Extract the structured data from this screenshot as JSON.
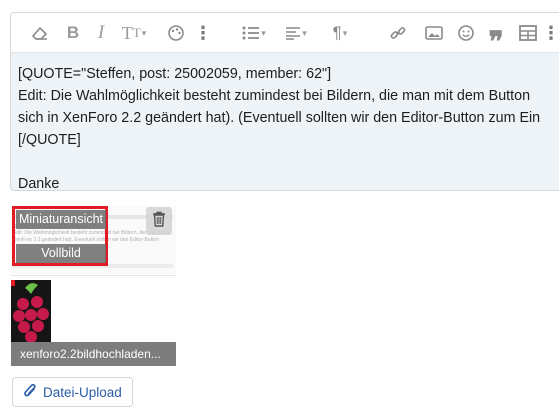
{
  "editor": {
    "content_lines": [
      "[QUOTE=\"Steffen, post: 25002059, member: 62\"]",
      "Edit: Die Wahlmöglichkeit besteht zumindest bei Bildern, die man mit dem Button",
      "sich in XenForo 2.2 geändert hat). (Eventuell sollten wir den Editor-Button zum Ein",
      "[/QUOTE]",
      "",
      "Danke"
    ],
    "toolbar_icons": [
      "eraser-icon",
      "bold-icon",
      "italic-icon",
      "text-size-icon",
      "palette-icon",
      "more-icon",
      "list-icon",
      "align-icon",
      "paragraph-icon",
      "link-icon",
      "image-icon",
      "smilie-icon",
      "quote-icon",
      "table-icon",
      "more-icon"
    ]
  },
  "attachments": [
    {
      "preview_lines": [
        "Steffen, post: 25002059, member: 62",
        "Edit: Die Wahlmöglichkeit besteht zumindest bei Bildern, die man mit d",
        "XenForo 2.2 geändert hat). Eventuell sollten wir den Editor-Button"
      ],
      "insert_thumbnail_label": "Miniaturansicht",
      "insert_full_label": "Vollbild"
    },
    {
      "filename": "xenforo2.2bildhochladen..."
    }
  ],
  "upload": {
    "label": "Datei-Upload"
  },
  "colors": {
    "accent": "#2a5ea8",
    "highlight": "#e21b24",
    "editor_bg": "#eef3f8"
  }
}
